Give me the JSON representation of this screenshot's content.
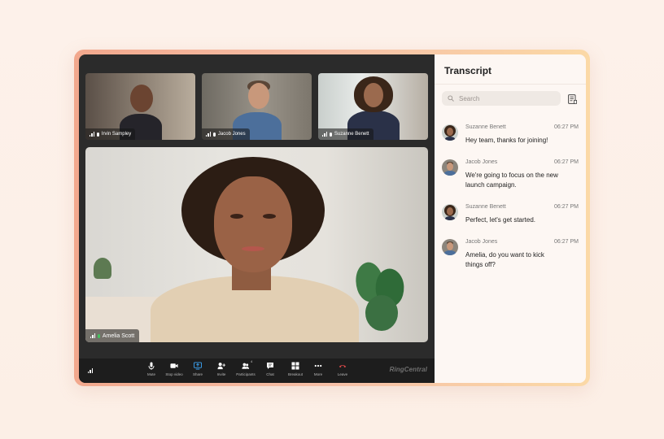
{
  "colors": {
    "page_background": "#fdf1ea",
    "frame_gradient_start": "#f2a88d",
    "frame_gradient_end": "#fbd9a6",
    "call_background": "#2b2b2b",
    "control_bar": "#1d1d1d",
    "share_active": "#3ba3f4",
    "leave_red": "#e44b4b",
    "mic_active_green": "#45c15e",
    "panel_background": "#fdf7f3"
  },
  "video_call": {
    "participants": [
      {
        "name": "Irvin Sampley",
        "icon": "mic-icon"
      },
      {
        "name": "Jacob Jones",
        "icon": "mic-icon"
      },
      {
        "name": "Suzanne Benett",
        "icon": "mic-icon"
      }
    ],
    "active_speaker": {
      "name": "Amelia Scott",
      "icon": "mic-active-icon"
    },
    "controls": [
      {
        "label": "Mute",
        "icon": "mic-icon"
      },
      {
        "label": "Stop video",
        "icon": "camera-icon"
      },
      {
        "label": "Share",
        "icon": "share-screen-icon"
      },
      {
        "label": "Invite",
        "icon": "add-person-icon"
      },
      {
        "label": "Participants",
        "icon": "participants-icon",
        "count": "4"
      },
      {
        "label": "Chat",
        "icon": "chat-icon"
      },
      {
        "label": "Breakout",
        "icon": "grid-icon"
      },
      {
        "label": "More",
        "icon": "more-icon"
      },
      {
        "label": "Leave",
        "icon": "phone-hangup-icon"
      }
    ],
    "brand": "RingCentral"
  },
  "transcript": {
    "title": "Transcript",
    "search_placeholder": "Search",
    "messages": [
      {
        "speaker": "Suzanne Benett",
        "time": "06:27 PM",
        "text": "Hey team, thanks for joining!"
      },
      {
        "speaker": "Jacob Jones",
        "time": "06:27 PM",
        "text": "We're going to focus on the new launch campaign."
      },
      {
        "speaker": "Suzanne Benett",
        "time": "06:27 PM",
        "text": "Perfect, let's get started."
      },
      {
        "speaker": "Jacob Jones",
        "time": "06:27 PM",
        "text": "Amelia, do you want to kick things off?"
      }
    ]
  }
}
